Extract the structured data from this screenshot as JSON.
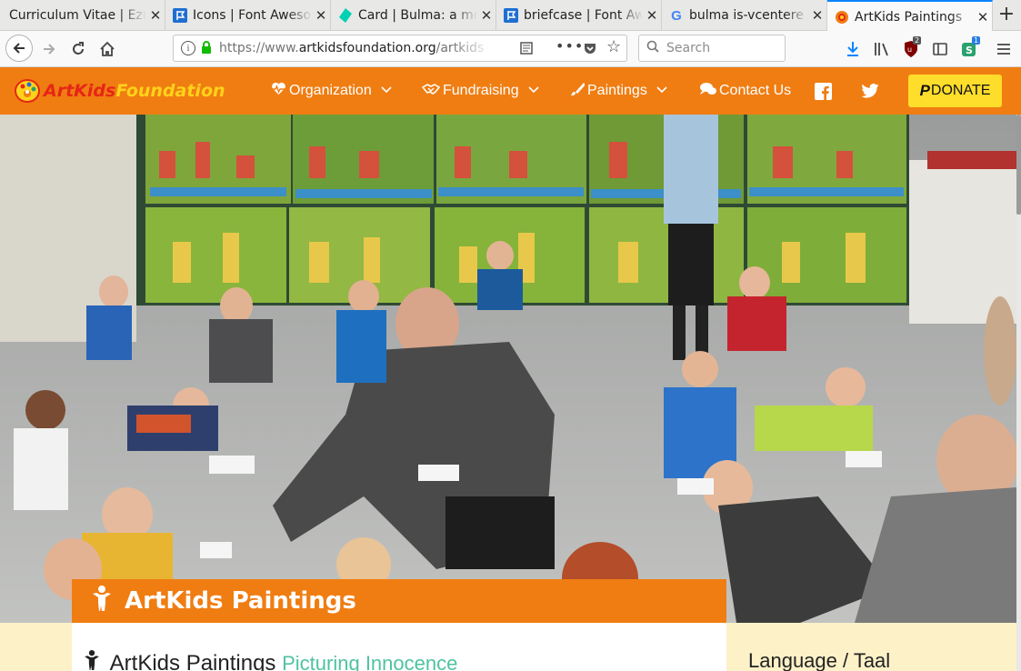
{
  "browser": {
    "tabs": [
      {
        "title": "Curriculum Vitae | Ezr",
        "icon": "document-icon"
      },
      {
        "title": "Icons | Font Awesome",
        "icon": "flag-icon"
      },
      {
        "title": "Card | Bulma: a mo",
        "icon": "bulma-icon"
      },
      {
        "title": "briefcase | Font Aw",
        "icon": "flag-icon"
      },
      {
        "title": "bulma is-vcentere",
        "icon": "google-icon"
      },
      {
        "title": "ArtKids Paintings",
        "icon": "artkids-icon"
      }
    ],
    "url_prefix": "https://www.",
    "url_domain": "artkidsfoundation.org",
    "url_path": "/artkids",
    "search_placeholder": "Search",
    "ublock_badge": "2",
    "sync_badge": "1"
  },
  "site": {
    "logo_part1": "ArtKids",
    "logo_part2": "Foundation",
    "nav": [
      {
        "label": "Organization",
        "icon": "heartbeat-icon",
        "dropdown": true
      },
      {
        "label": "Fundraising",
        "icon": "handshake-icon",
        "dropdown": true
      },
      {
        "label": "Paintings",
        "icon": "paintbrush-icon",
        "dropdown": true
      },
      {
        "label": "Contact Us",
        "icon": "comments-icon",
        "dropdown": false
      }
    ],
    "donate_label": "DONATE",
    "banner_title": "ArtKids Paintings",
    "content_title": "ArtKids Paintings",
    "content_subtitle": "Picturing Innocence",
    "sidebar_title": "Language / Taal",
    "colors": {
      "brand_orange": "#f07d12",
      "donate_yellow": "#ffdd2b",
      "subtitle_teal": "#4fc3a1",
      "sidebar_bg": "#fdf1c8"
    }
  }
}
